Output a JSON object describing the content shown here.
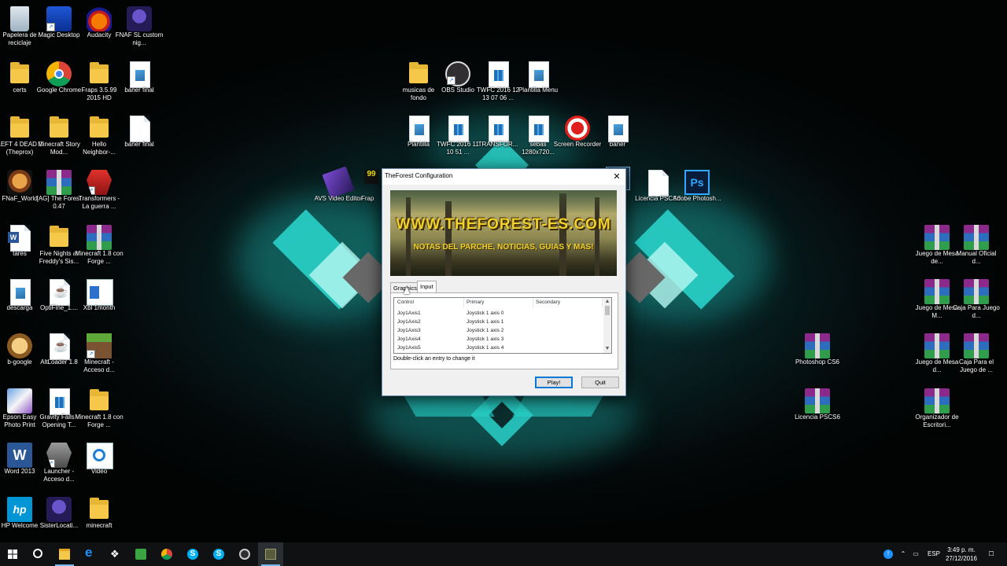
{
  "desktop_icons": [
    {
      "label": "Papelera de reciclaje",
      "icon": "recycle-bin-icon"
    },
    {
      "label": "Magic Desktop",
      "icon": "magic-desktop-icon"
    },
    {
      "label": "Audacity",
      "icon": "audacity-icon"
    },
    {
      "label": "FNAF SL custom nig...",
      "icon": "fnaf-icon"
    },
    {
      "label": "certs",
      "icon": "folder-icon"
    },
    {
      "label": "Google Chrome",
      "icon": "chrome-icon"
    },
    {
      "label": "Fraps 3.5.99 2015 HD",
      "icon": "folder-icon"
    },
    {
      "label": "baner final",
      "icon": "image-file-icon"
    },
    {
      "label": "LEFT 4 DEAD 2 (Theprox)",
      "icon": "folder-icon"
    },
    {
      "label": "Minecraft Story Mod...",
      "icon": "folder-icon"
    },
    {
      "label": "Hello Neighbor-...",
      "icon": "folder-icon"
    },
    {
      "label": "baner final",
      "icon": "document-icon"
    },
    {
      "label": "FNaF_World",
      "icon": "fnaf-world-icon"
    },
    {
      "label": "[AG] The Forest 0.47",
      "icon": "winrar-icon"
    },
    {
      "label": "Transformers - La guerra ...",
      "icon": "transformers-icon"
    },
    {
      "label": "tares",
      "icon": "word-doc-icon"
    },
    {
      "label": "Five Nights at Freddy's Sis...",
      "icon": "folder-icon"
    },
    {
      "label": "Minecraft 1.8 con Forge ...",
      "icon": "winrar-icon"
    },
    {
      "label": "descarga",
      "icon": "image-file-icon"
    },
    {
      "label": "OptiFine_1....",
      "icon": "java-icon"
    },
    {
      "label": "Xbl 1month",
      "icon": "window-app-icon"
    },
    {
      "label": "b-google",
      "icon": "b-google-icon"
    },
    {
      "label": "AltLoader 1.8",
      "icon": "java-icon"
    },
    {
      "label": "Minecraft - Acceso d...",
      "icon": "minecraft-icon"
    },
    {
      "label": "Epson Easy Photo Print",
      "icon": "epson-icon"
    },
    {
      "label": "Gravity Falls - Opening T...",
      "icon": "video-file-icon"
    },
    {
      "label": "Minecraft 1.8 con Forge ...",
      "icon": "folder-icon"
    },
    {
      "label": "Word 2013",
      "icon": "word-icon"
    },
    {
      "label": "Launcher - Acceso d...",
      "icon": "transformers-icon"
    },
    {
      "label": "Video",
      "icon": "video-app-icon"
    },
    {
      "label": "HP Welcome",
      "icon": "hp-icon"
    },
    {
      "label": "SisterLocati...",
      "icon": "fnaf-icon"
    },
    {
      "label": "minecraft",
      "icon": "folder-icon"
    },
    {
      "label": "musicas de fondo",
      "icon": "folder-icon"
    },
    {
      "label": "OBS Studio",
      "icon": "obs-icon"
    },
    {
      "label": "TWFC 2016 12 13 07 06 ...",
      "icon": "video-file-icon"
    },
    {
      "label": "Plantilla Menu",
      "icon": "image-file-icon"
    },
    {
      "label": "Plantilla",
      "icon": "image-file-icon"
    },
    {
      "label": "TWFC 2016 11 10 51 ...",
      "icon": "video-file-icon"
    },
    {
      "label": "TRANSFOR...",
      "icon": "video-file-icon"
    },
    {
      "label": "sebas 1280x720...",
      "icon": "video-file-icon"
    },
    {
      "label": "Screen Recorder",
      "icon": "screen-recorder-icon"
    },
    {
      "label": "baner",
      "icon": "image-file-icon"
    },
    {
      "label": "AVS Video Editor",
      "icon": "avs-icon"
    },
    {
      "label": "Frap",
      "icon": "fraps-icon"
    },
    {
      "label": "Licencia PSCS6",
      "icon": "document-icon"
    },
    {
      "label": "Adobe Photosh...",
      "icon": "photoshop-icon"
    },
    {
      "label": "Juego de Mesa de...",
      "icon": "winrar-icon"
    },
    {
      "label": "Manual Oficial d...",
      "icon": "winrar-icon"
    },
    {
      "label": "Juego de Mesa M...",
      "icon": "winrar-icon"
    },
    {
      "label": "Caja Para Juego d...",
      "icon": "winrar-icon"
    },
    {
      "label": "Juego de Mesa d...",
      "icon": "winrar-icon"
    },
    {
      "label": "Caja Para el Juego de ...",
      "icon": "winrar-icon"
    },
    {
      "label": "Photoshop CS6",
      "icon": "winrar-icon"
    },
    {
      "label": "Licencia PSCS6",
      "icon": "winrar-icon"
    },
    {
      "label": "Organizador de Escritori...",
      "icon": "winrar-icon"
    }
  ],
  "dialog": {
    "title": "TheForest Configuration",
    "close_icon": "close-icon",
    "banner_line1": "WWW.THEFOREST-ES.COM",
    "banner_line2": "NOTAS DEL PARCHE, NOTICIAS, GUIAS Y MAS!",
    "tabs": [
      "Graphics",
      "Input"
    ],
    "active_tab": "Input",
    "columns": [
      "Control",
      "Primary",
      "Secondary"
    ],
    "rows": [
      {
        "control": "Joy1Axis1",
        "primary": "Joystick 1 axis 0",
        "secondary": ""
      },
      {
        "control": "Joy1Axis2",
        "primary": "Joystick 1 axis 1",
        "secondary": ""
      },
      {
        "control": "Joy1Axis3",
        "primary": "Joystick 1 axis 2",
        "secondary": ""
      },
      {
        "control": "Joy1Axis4",
        "primary": "Joystick 1 axis 3",
        "secondary": ""
      },
      {
        "control": "Joy1Axis5",
        "primary": "Joystick 1 axis 4",
        "secondary": ""
      }
    ],
    "hint": "Double-click an entry to change it",
    "play_label": "Play!",
    "quit_label": "Quit"
  },
  "taskbar": {
    "items": [
      "start-icon",
      "search-icon",
      "file-explorer-icon",
      "edge-icon",
      "dropbox-icon",
      "green-app-icon",
      "chrome-icon",
      "skype-icon",
      "skype-icon",
      "obs-icon",
      "the-forest-icon"
    ],
    "language": "ESP",
    "time": "3:49 p. m.",
    "date": "27/12/2016"
  },
  "colors": {
    "accent": "#0078d7",
    "banner_text": "#f1d22c",
    "wallpaper_glow": "#1fd1c7"
  }
}
